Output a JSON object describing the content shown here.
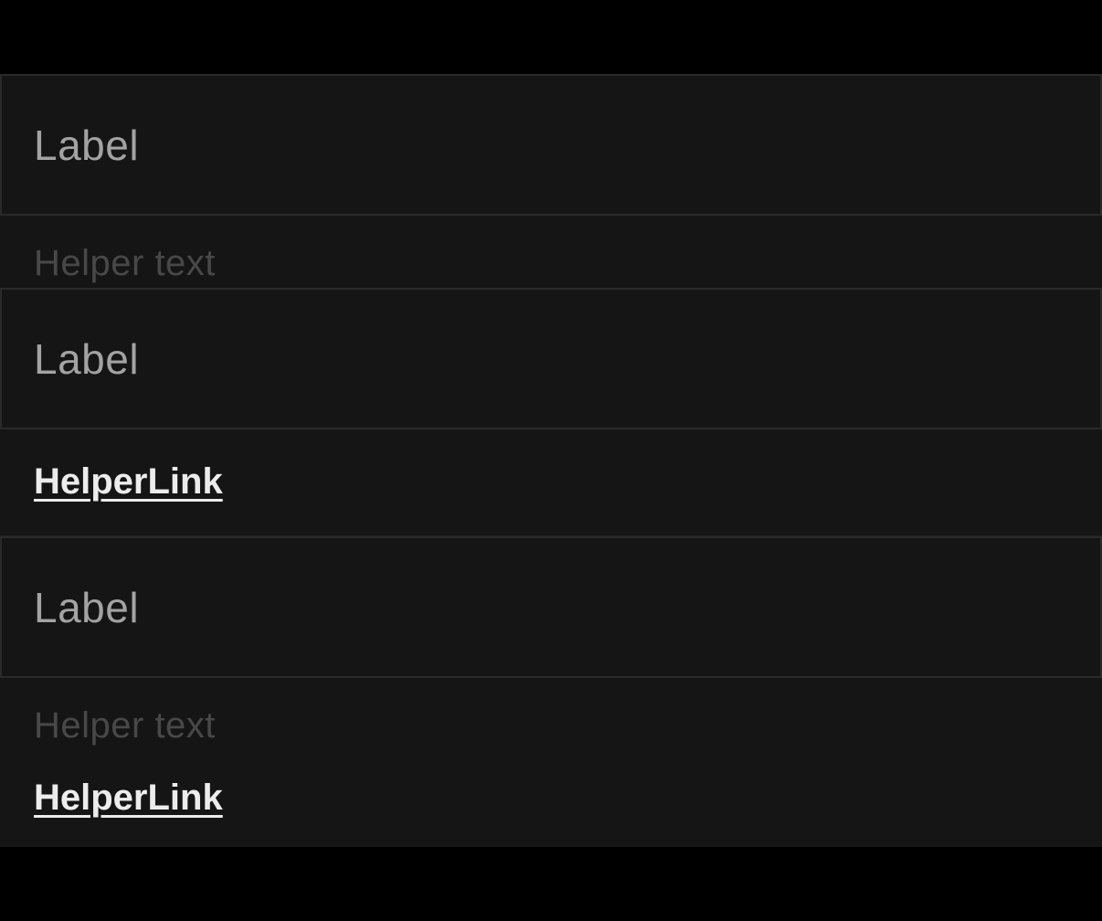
{
  "fields": [
    {
      "label": "Label",
      "helper_text": "Helper text"
    },
    {
      "label": "Label",
      "helper_link": "HelperLink"
    },
    {
      "label": "Label",
      "helper_text": "Helper text",
      "helper_link": "HelperLink"
    }
  ],
  "colors": {
    "background": "#000000",
    "panel": "#151515",
    "border": "#2a2a2a",
    "label": "#a3a3a3",
    "helper_text": "#484848",
    "helper_link": "#ececec"
  }
}
